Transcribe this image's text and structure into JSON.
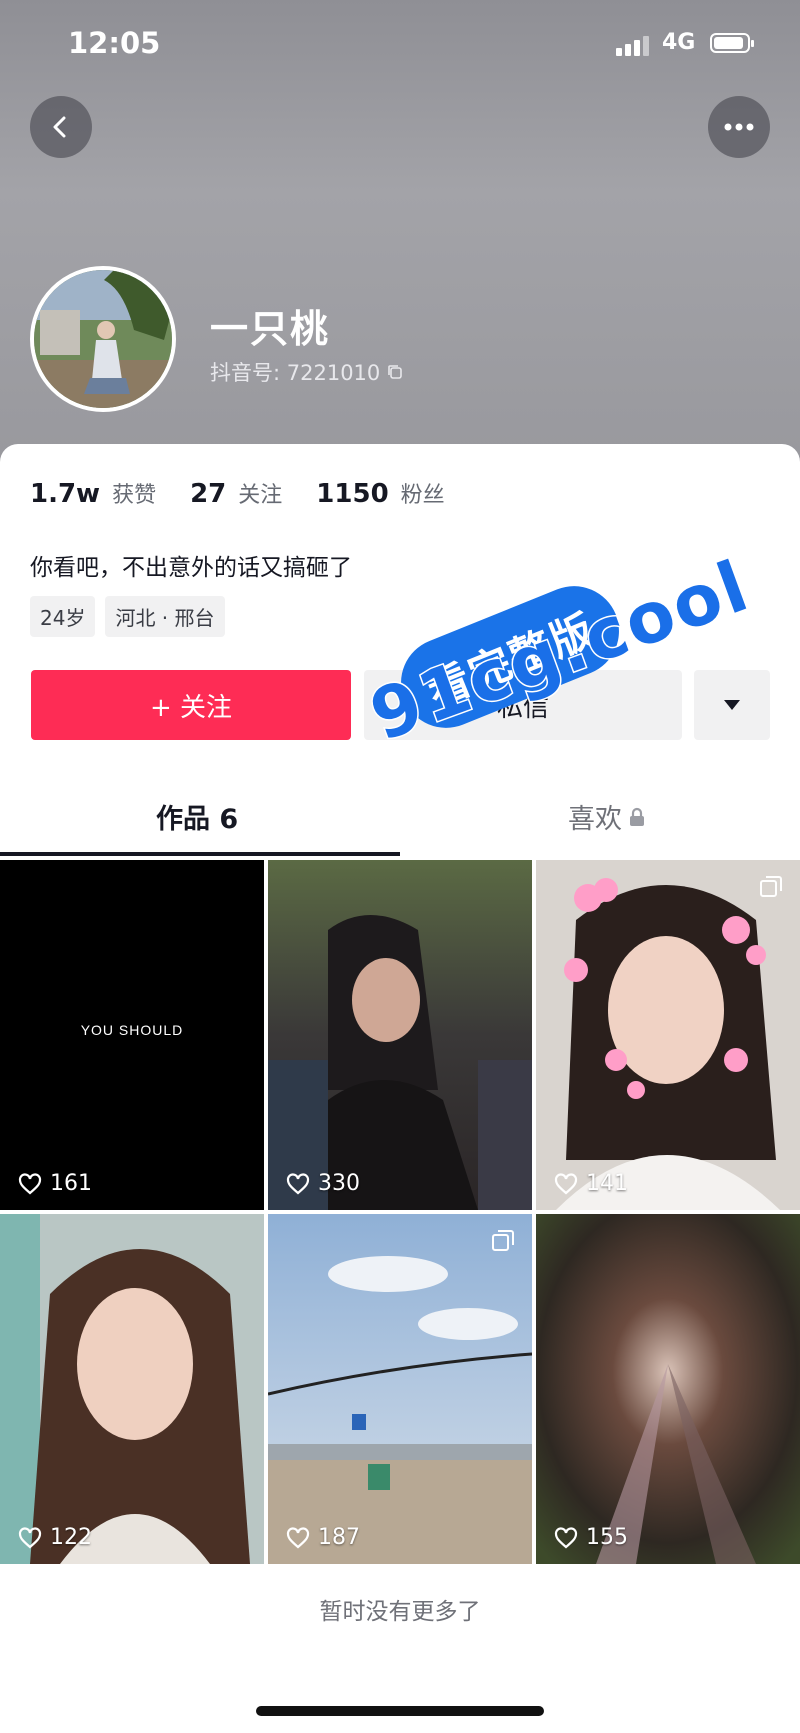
{
  "status_bar": {
    "time": "12:05",
    "network": "4G",
    "battery_level": 0.9
  },
  "header": {
    "back_icon": "chevron-left-icon",
    "more_icon": "more-horizontal-icon"
  },
  "profile": {
    "name": "一只桃",
    "id_label": "抖音号: 7221010",
    "stats": [
      {
        "num": "1.7w",
        "label": "获赞"
      },
      {
        "num": "27",
        "label": "关注"
      },
      {
        "num": "1150",
        "label": "粉丝"
      }
    ],
    "bio": "你看吧，不出意外的话又搞砸了",
    "tags": [
      "24岁",
      "河北 · 邢台"
    ]
  },
  "actions": {
    "follow_label": "+ 关注",
    "message_label": "私信",
    "accent": "#fe2c55"
  },
  "tabs": {
    "works": "作品 6",
    "likes": "喜欢"
  },
  "videos": [
    {
      "likes": "161",
      "caption": "YOU SHOULD",
      "multi": false
    },
    {
      "likes": "330",
      "multi": false
    },
    {
      "likes": "141",
      "multi": true
    },
    {
      "likes": "122",
      "multi": false
    },
    {
      "likes": "187",
      "multi": true
    },
    {
      "likes": "155",
      "multi": false
    }
  ],
  "footer": "暂时没有更多了",
  "watermark": {
    "line1": "看完整版",
    "line2": "91cg.cool",
    "color": "#1a73e8"
  }
}
